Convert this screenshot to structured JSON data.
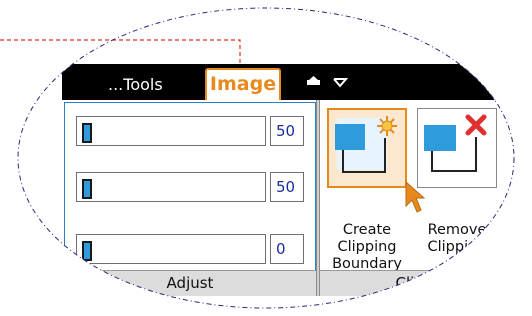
{
  "tabs": {
    "tools_label": "...Tools",
    "image_label": "Image"
  },
  "adjust": {
    "sliders": [
      {
        "value": "50"
      },
      {
        "value": "50"
      },
      {
        "value": "0"
      }
    ],
    "group_label": "Adjust"
  },
  "clipping": {
    "create_lines": [
      "Create",
      "Clipping",
      "Boundary"
    ],
    "remove_lines": [
      "Remove",
      "Clipping"
    ],
    "group_label": "Clipping"
  },
  "colors": {
    "accent": "#e8891d",
    "blue": "#2d9bdc",
    "tabbar": "#000000",
    "callout_line": "#e0301e",
    "ellipse_border": "#2b2b7a"
  },
  "icons": {
    "create": "create-clipping-boundary-icon",
    "remove": "remove-clipping-icon",
    "cursor": "arrow-cursor-icon"
  }
}
